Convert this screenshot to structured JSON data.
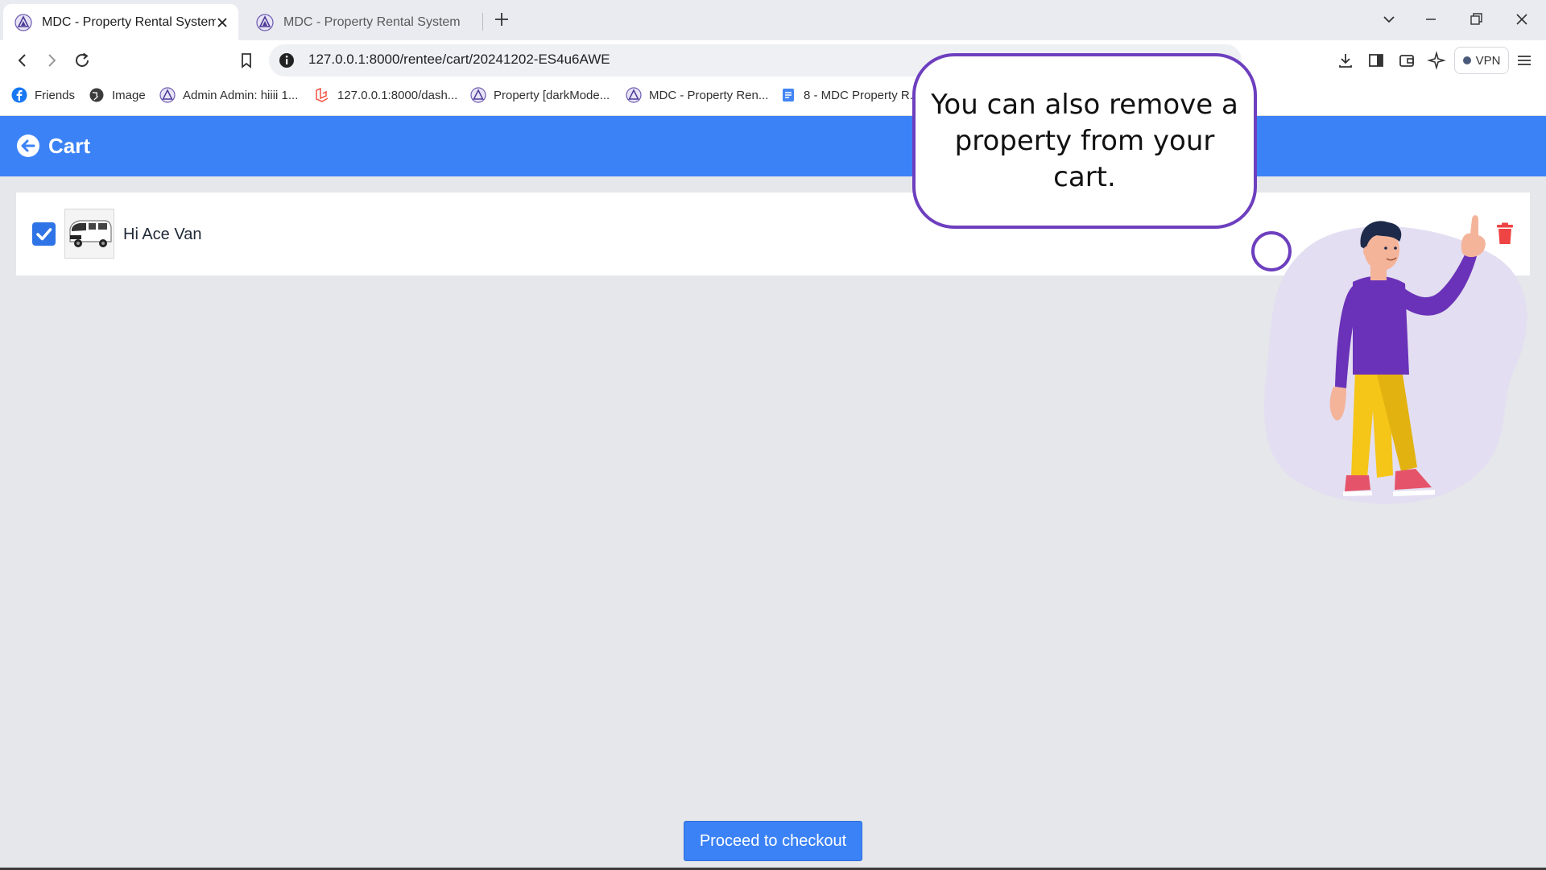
{
  "browser": {
    "tabs": [
      {
        "title": "MDC - Property Rental System",
        "active": true,
        "icon": "mdc-logo-icon"
      },
      {
        "title": "MDC - Property Rental System",
        "active": false,
        "icon": "mdc-logo-icon"
      }
    ],
    "url": "127.0.0.1:8000/rentee/cart/20241202-ES4u6AWE",
    "vpn_label": "VPN",
    "bookmarks": [
      {
        "label": "Friends",
        "icon": "facebook-icon"
      },
      {
        "label": "Image",
        "icon": "globe-icon"
      },
      {
        "label": "Admin Admin: hiiii 1...",
        "icon": "mdc-logo-icon"
      },
      {
        "label": "127.0.0.1:8000/dash...",
        "icon": "laravel-icon"
      },
      {
        "label": "Property [darkMode...",
        "icon": "mdc-logo-icon"
      },
      {
        "label": "MDC - Property Ren...",
        "icon": "mdc-logo-icon"
      },
      {
        "label": "8 - MDC Property R...",
        "icon": "docs-icon"
      }
    ]
  },
  "page": {
    "header_title": "Cart",
    "cart_items": [
      {
        "name": "Hi Ace Van",
        "checked": true
      }
    ],
    "checkout_label": "Proceed to checkout"
  },
  "tutorial": {
    "message": "You can also remove a property from your cart."
  },
  "colors": {
    "primary": "#3b82f6",
    "trash": "#ef4444",
    "bubble_border": "#6d3fbf",
    "page_bg": "#e5e7eb"
  }
}
